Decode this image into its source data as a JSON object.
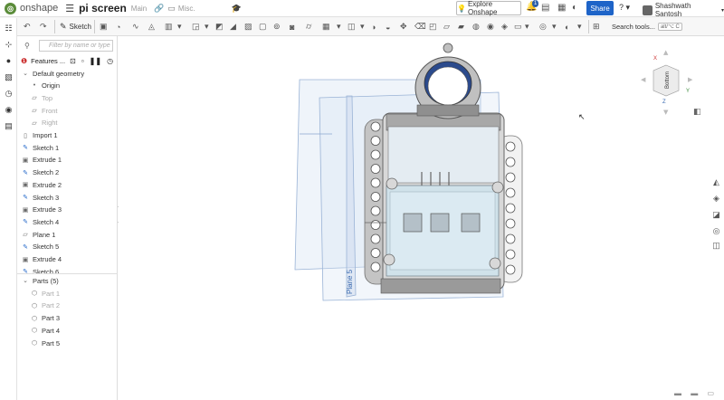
{
  "header": {
    "logo_text": "onshape",
    "doc_title": "pi screen",
    "branch": "Main",
    "folder": "Misc.",
    "explore_label": "Explore Onshape",
    "notification_count": "1",
    "share_label": "Share",
    "help_label": "?",
    "user_name": "Shashwath Santosh"
  },
  "toolbar": {
    "sketch_label": "Sketch",
    "search_label": "Search tools...",
    "search_shortcut": "alt/⌥ C"
  },
  "panel": {
    "filter_placeholder": "Filter by name or type",
    "features_label": "Features ...",
    "features": [
      {
        "label": "Default geometry",
        "kind": "group"
      },
      {
        "label": "Origin",
        "kind": "origin"
      },
      {
        "label": "Top",
        "kind": "plane",
        "dim": true
      },
      {
        "label": "Front",
        "kind": "plane",
        "dim": true
      },
      {
        "label": "Right",
        "kind": "plane",
        "dim": true
      },
      {
        "label": "Import 1",
        "kind": "import"
      },
      {
        "label": "Sketch 1",
        "kind": "sketch"
      },
      {
        "label": "Extrude 1",
        "kind": "extrude"
      },
      {
        "label": "Sketch 2",
        "kind": "sketch"
      },
      {
        "label": "Extrude 2",
        "kind": "extrude"
      },
      {
        "label": "Sketch 3",
        "kind": "sketch"
      },
      {
        "label": "Extrude 3",
        "kind": "extrude"
      },
      {
        "label": "Sketch 4",
        "kind": "sketch"
      },
      {
        "label": "Plane 1",
        "kind": "plane"
      },
      {
        "label": "Sketch 5",
        "kind": "sketch"
      },
      {
        "label": "Extrude 4",
        "kind": "extrude"
      },
      {
        "label": "Sketch 6",
        "kind": "sketch"
      }
    ],
    "parts_label": "Parts (5)",
    "parts": [
      {
        "label": "Part 1",
        "dim": true
      },
      {
        "label": "Part 2",
        "dim": true
      },
      {
        "label": "Part 3",
        "dim": false
      },
      {
        "label": "Part 4",
        "dim": false
      },
      {
        "label": "Part 5",
        "dim": false
      }
    ]
  },
  "viewport": {
    "plane_label": "Plane 5",
    "view_cube_label": "Bottom",
    "axis_x": "X",
    "axis_y": "Y",
    "axis_z": "Z"
  },
  "colors": {
    "accent": "#1e64c8",
    "logo": "#5b8c3a",
    "plane_fill": "#dbe6f4",
    "plane_stroke": "#9ab3d6",
    "model_gray": "#c8c8c8",
    "model_dark": "#6f6f6f",
    "glass": "#cfe3ec",
    "ring_blue": "#2b4a8c"
  }
}
